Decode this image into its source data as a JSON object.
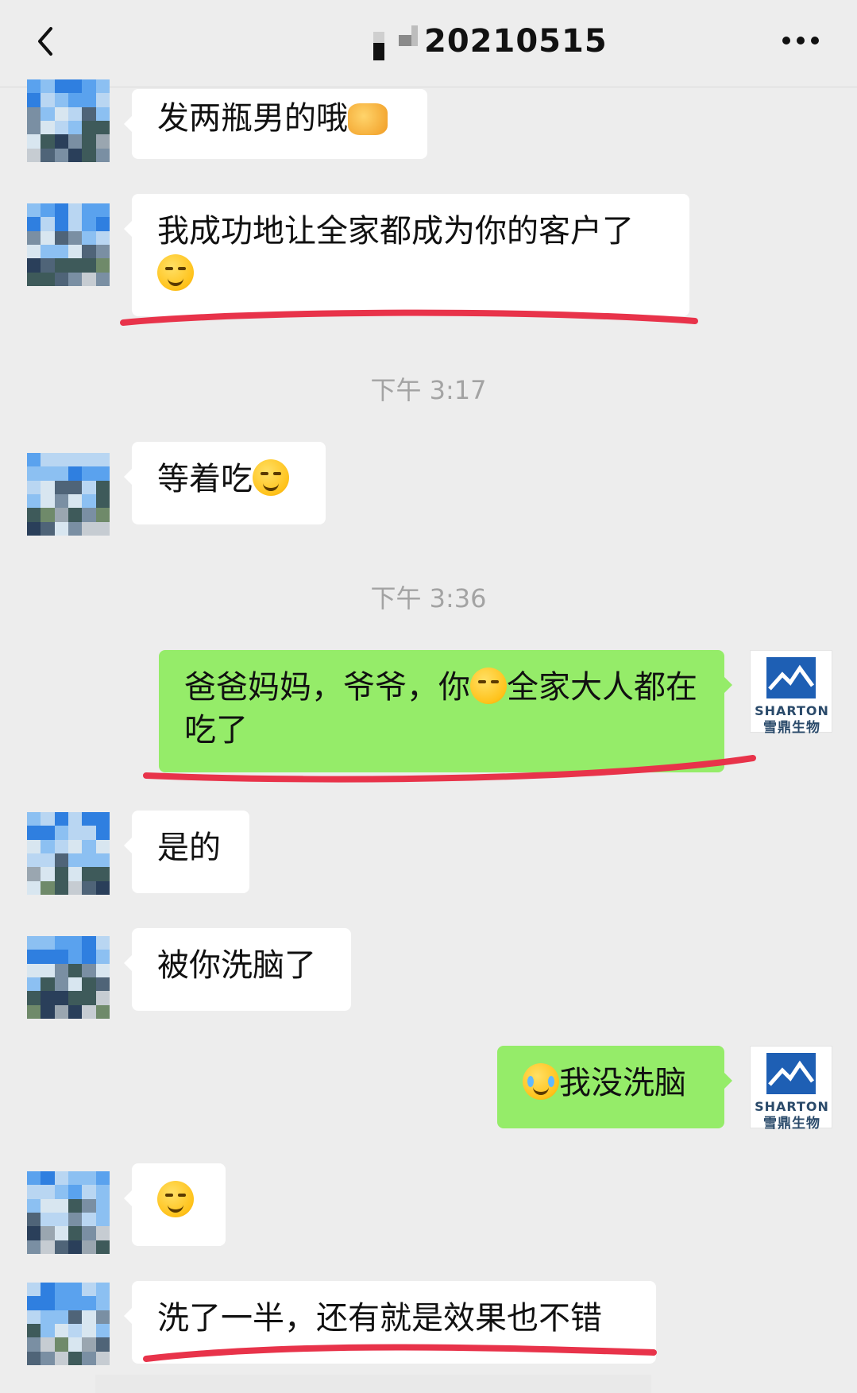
{
  "header": {
    "title": "20210515",
    "back_icon": "chevron-left-icon",
    "more_icon": "ellipsis-icon"
  },
  "brand": {
    "name_en": "SHARTON",
    "name_cn": "雪鼎生物",
    "color": "#1e5fb4"
  },
  "messages": [
    {
      "side": "in",
      "text": "发两瓶男的哦",
      "emoji": "handshake-emoji"
    },
    {
      "side": "in",
      "text": "我成功地让全家都成为你的客户了",
      "emoji": "shush-emoji",
      "highlighted": true
    },
    {
      "type": "time",
      "text": "下午 3:17"
    },
    {
      "side": "in",
      "text": "等着吃",
      "emoji": "shush-emoji"
    },
    {
      "type": "time",
      "text": "下午 3:36"
    },
    {
      "side": "out",
      "text_a": "爸爸妈妈，爷爷，你",
      "text_b": "全家大人都在吃了",
      "emoji": "hand-over-mouth-emoji",
      "highlighted": true
    },
    {
      "side": "in",
      "text": "是的"
    },
    {
      "side": "in",
      "text": "被你洗脑了"
    },
    {
      "side": "out",
      "text": "我没洗脑",
      "emoji": "crying-emoji"
    },
    {
      "side": "in",
      "emoji": "grinning-emoji"
    },
    {
      "side": "in",
      "text": "洗了一半，还有就是效果也不错",
      "highlighted": true
    }
  ],
  "colors": {
    "background": "#ededed",
    "incoming_bubble": "#ffffff",
    "outgoing_bubble": "#95ec69",
    "highlight_mark": "#e8334a"
  }
}
